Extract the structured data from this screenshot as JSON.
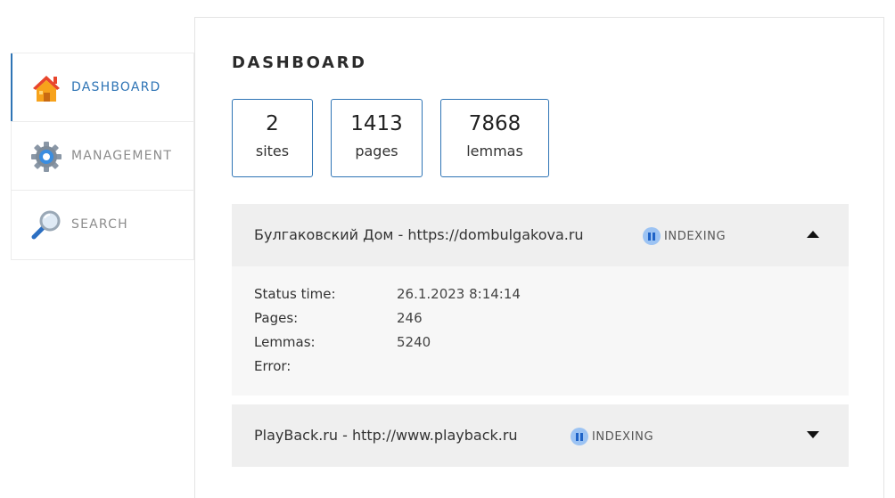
{
  "sidebar": {
    "items": [
      {
        "label": "DASHBOARD",
        "icon": "home-icon",
        "active": true
      },
      {
        "label": "MANAGEMENT",
        "icon": "gear-icon",
        "active": false
      },
      {
        "label": "SEARCH",
        "icon": "magnifier-icon",
        "active": false
      }
    ]
  },
  "main": {
    "title": "DASHBOARD",
    "stats": [
      {
        "value": "2",
        "label": "sites"
      },
      {
        "value": "1413",
        "label": "pages"
      },
      {
        "value": "7868",
        "label": "lemmas"
      }
    ],
    "sites": [
      {
        "title": "Булгаковский Дом - https://dombulgakova.ru",
        "status": "INDEXING",
        "expanded": true,
        "details": {
          "status_time_label": "Status time:",
          "status_time": "26.1.2023 8:14:14",
          "pages_label": "Pages:",
          "pages": "246",
          "lemmas_label": "Lemmas:",
          "lemmas": "5240",
          "error_label": "Error:",
          "error": ""
        }
      },
      {
        "title": "PlayBack.ru - http://www.playback.ru",
        "status": "INDEXING",
        "expanded": false
      }
    ]
  },
  "colors": {
    "accent": "#2e74b5",
    "status_icon_bg": "#9cc3f3",
    "status_icon_fg": "#1f63c7",
    "header_bg": "#efefef",
    "body_bg": "#f7f7f7"
  }
}
